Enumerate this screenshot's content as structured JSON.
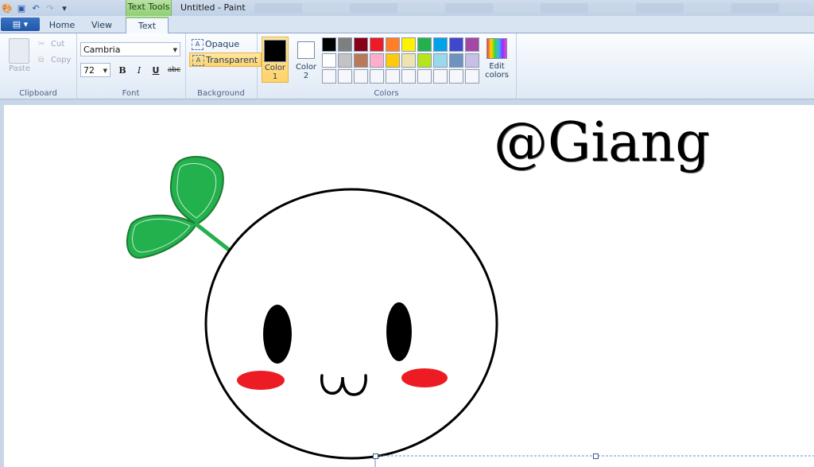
{
  "window": {
    "title": "Untitled - Paint",
    "contextual_tab": "Text Tools"
  },
  "tabs": [
    {
      "label": "Home"
    },
    {
      "label": "View"
    },
    {
      "label": "Text",
      "active": true
    }
  ],
  "file_button": {
    "icon": "menu-icon"
  },
  "clipboard": {
    "paste_label": "Paste",
    "cut_label": "Cut",
    "copy_label": "Copy",
    "group_label": "Clipboard"
  },
  "font": {
    "family": "Cambria",
    "size": "72",
    "bold": "B",
    "italic": "I",
    "underline": "U",
    "strike": "abc",
    "group_label": "Font"
  },
  "background": {
    "opaque_label": "Opaque",
    "transparent_label": "Transparent",
    "selected": "Transparent",
    "group_label": "Background"
  },
  "colors": {
    "color1_label": "Color",
    "color1_num": "1",
    "color1_value": "#000000",
    "color2_label": "Color",
    "color2_num": "2",
    "color2_value": "#ffffff",
    "palette": [
      "#000000",
      "#7f7f7f",
      "#880015",
      "#ed1c24",
      "#ff7f27",
      "#fff200",
      "#22b14c",
      "#00a2e8",
      "#3f48cc",
      "#a349a4",
      "#ffffff",
      "#c3c3c3",
      "#b97a57",
      "#ffaec9",
      "#ffc90e",
      "#efe4b0",
      "#b5e61d",
      "#99d9ea",
      "#7092be",
      "#c8bfe7",
      "#f5f7fa",
      "#f5f7fa",
      "#f5f7fa",
      "#f5f7fa",
      "#f5f7fa",
      "#f5f7fa",
      "#f5f7fa",
      "#f5f7fa",
      "#f5f7fa",
      "#f5f7fa"
    ],
    "edit_label_1": "Edit",
    "edit_label_2": "colors",
    "group_label": "Colors"
  },
  "canvas": {
    "text": "@Giang",
    "leaf_color": "#22b14c",
    "blush_color": "#ed1c24"
  }
}
